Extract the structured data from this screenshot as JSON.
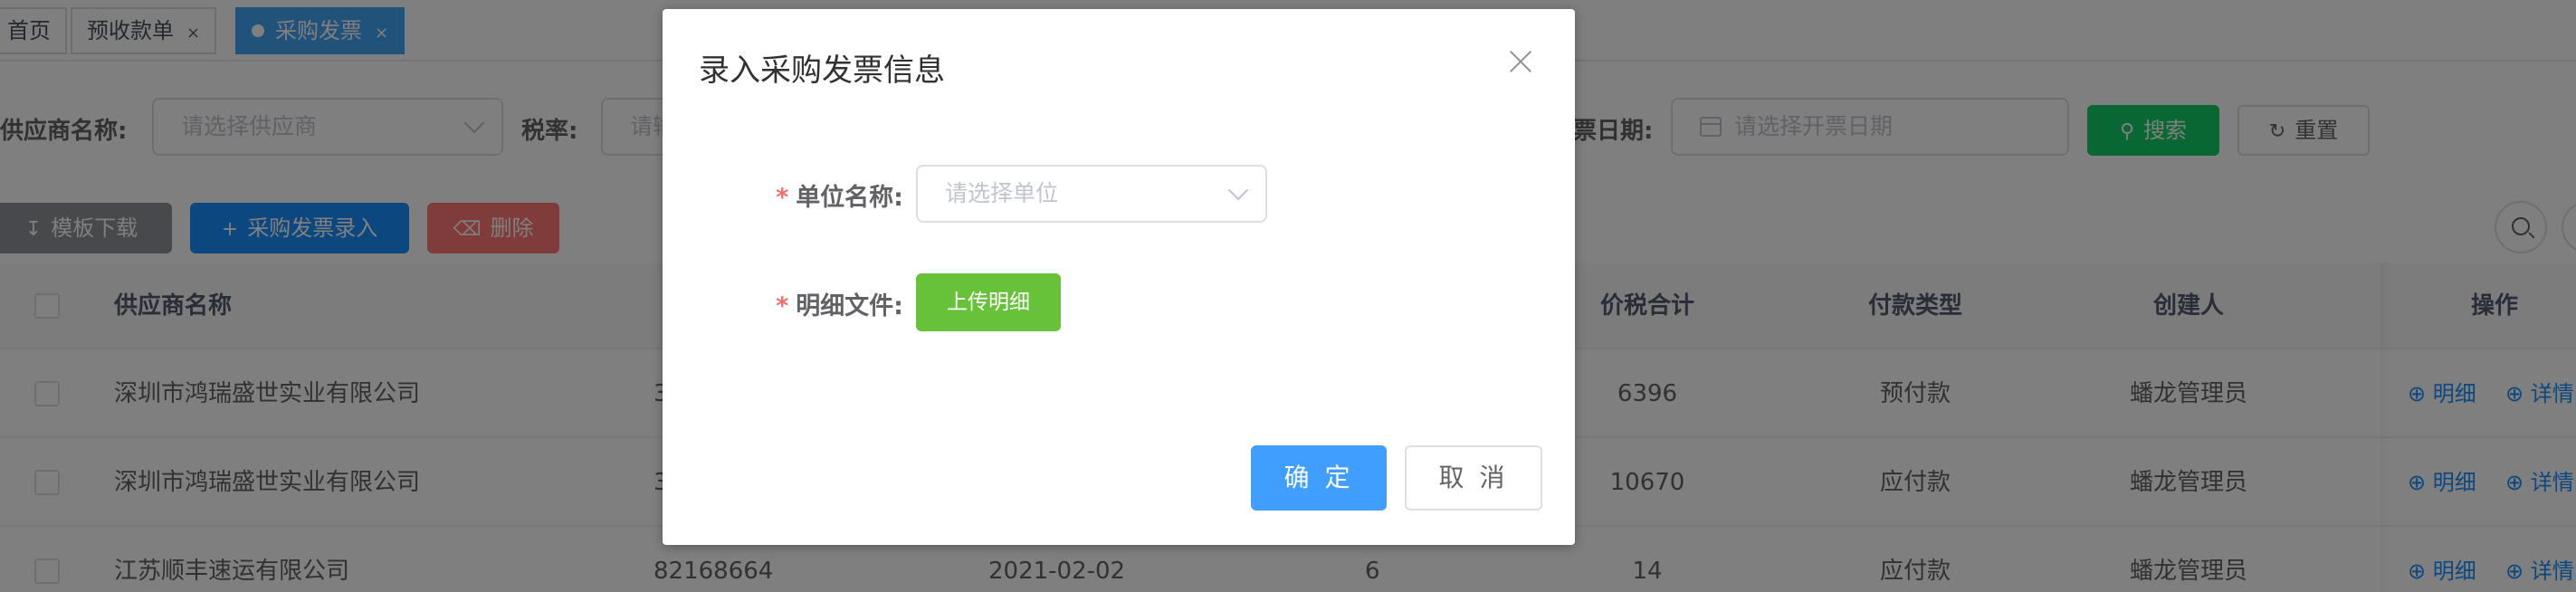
{
  "tags": [
    {
      "label": "首页",
      "closable": false,
      "active": false
    },
    {
      "label": "预收款单",
      "closable": true,
      "active": false
    },
    {
      "label": "采购发票",
      "closable": true,
      "active": true
    }
  ],
  "tag_close_glyph": "×",
  "search": {
    "supplier_label": "供应商名称:",
    "supplier_placeholder": "请选择供应商",
    "tax_rate_label": "税率:",
    "tax_rate_placeholder": "请输",
    "invoice_date_label": "票日期:",
    "invoice_date_placeholder": "请选择开票日期",
    "search_button": "搜索",
    "reset_button": "重置"
  },
  "toolbar": {
    "template_download": "模板下载",
    "purchase_invoice_entry": "采购发票录入",
    "delete": "删除"
  },
  "table": {
    "columns": {
      "supplier": "供应商名称",
      "total_with_tax": "价税合计",
      "payment_type": "付款类型",
      "creator": "创建人",
      "actions": "操作"
    },
    "rows": [
      {
        "supplier": "深圳市鸿瑞盛世实业有限公司",
        "invoice_no": "3",
        "date": "",
        "qty": "",
        "total": "6396",
        "payment_type": "预付款",
        "creator": "蟠龙管理员"
      },
      {
        "supplier": "深圳市鸿瑞盛世实业有限公司",
        "invoice_no": "3",
        "date": "",
        "qty": "",
        "total": "10670",
        "payment_type": "应付款",
        "creator": "蟠龙管理员"
      },
      {
        "supplier": "江苏顺丰速运有限公司",
        "invoice_no": "82168664",
        "date": "2021-02-02",
        "qty": "6",
        "total": "14",
        "payment_type": "应付款",
        "creator": "蟠龙管理员"
      }
    ],
    "row_actions": {
      "detail": "明细",
      "view": "详情"
    }
  },
  "dialog": {
    "title": "录入采购发票信息",
    "unit_label": "单位名称:",
    "unit_placeholder": "请选择单位",
    "detail_file_label": "明细文件:",
    "upload_button": "上传明细",
    "confirm_button": "确 定",
    "cancel_button": "取 消",
    "required_mark": "*"
  },
  "icons": {
    "search": "search-icon",
    "refresh": "refresh-icon",
    "download": "download-icon",
    "plus": "plus-icon",
    "delete": "trash-icon",
    "zoom": "zoom-in-icon",
    "close": "close-icon",
    "calendar": "calendar-icon",
    "chevron": "chevron-down-icon"
  },
  "colors": {
    "primary": "#1890ff",
    "success": "#13ce66",
    "upload_green": "#67c23a",
    "danger_light": "#ff7875",
    "required": "#f56c6c",
    "active_tag": "#42a5f5"
  }
}
